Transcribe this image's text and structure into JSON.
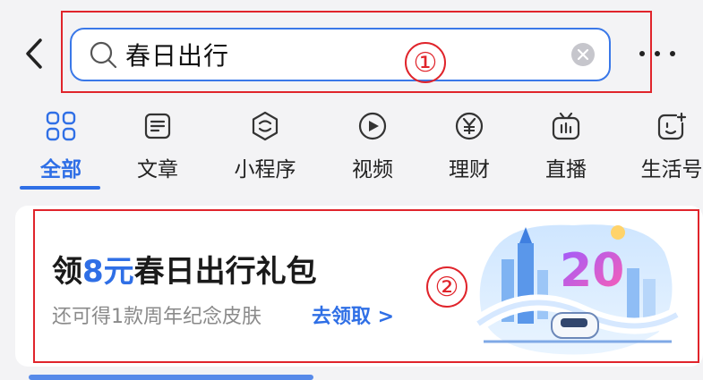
{
  "search": {
    "query": "春日出行",
    "annotation_marker": "①"
  },
  "tabs": [
    {
      "label": "全部",
      "icon": "grid-icon",
      "active": true
    },
    {
      "label": "文章",
      "icon": "article-icon",
      "active": false
    },
    {
      "label": "小程序",
      "icon": "miniprogram-icon",
      "active": false
    },
    {
      "label": "视频",
      "icon": "video-play-icon",
      "active": false
    },
    {
      "label": "理财",
      "icon": "yen-coin-icon",
      "active": false
    },
    {
      "label": "直播",
      "icon": "live-tv-icon",
      "active": false
    },
    {
      "label": "生活号",
      "icon": "life-account-icon",
      "active": false
    }
  ],
  "banner": {
    "title_prefix": "领",
    "title_amount": "8元",
    "title_suffix": "春日出行礼包",
    "subtitle": "还可得1款周年纪念皮肤",
    "link": "去领取 >",
    "annotation_marker": "②",
    "artwork": "spring-travel-train-illustration"
  },
  "colors": {
    "accent": "#2f6fe6",
    "annotation_red": "#e0242b",
    "background": "#f3f3f5"
  }
}
